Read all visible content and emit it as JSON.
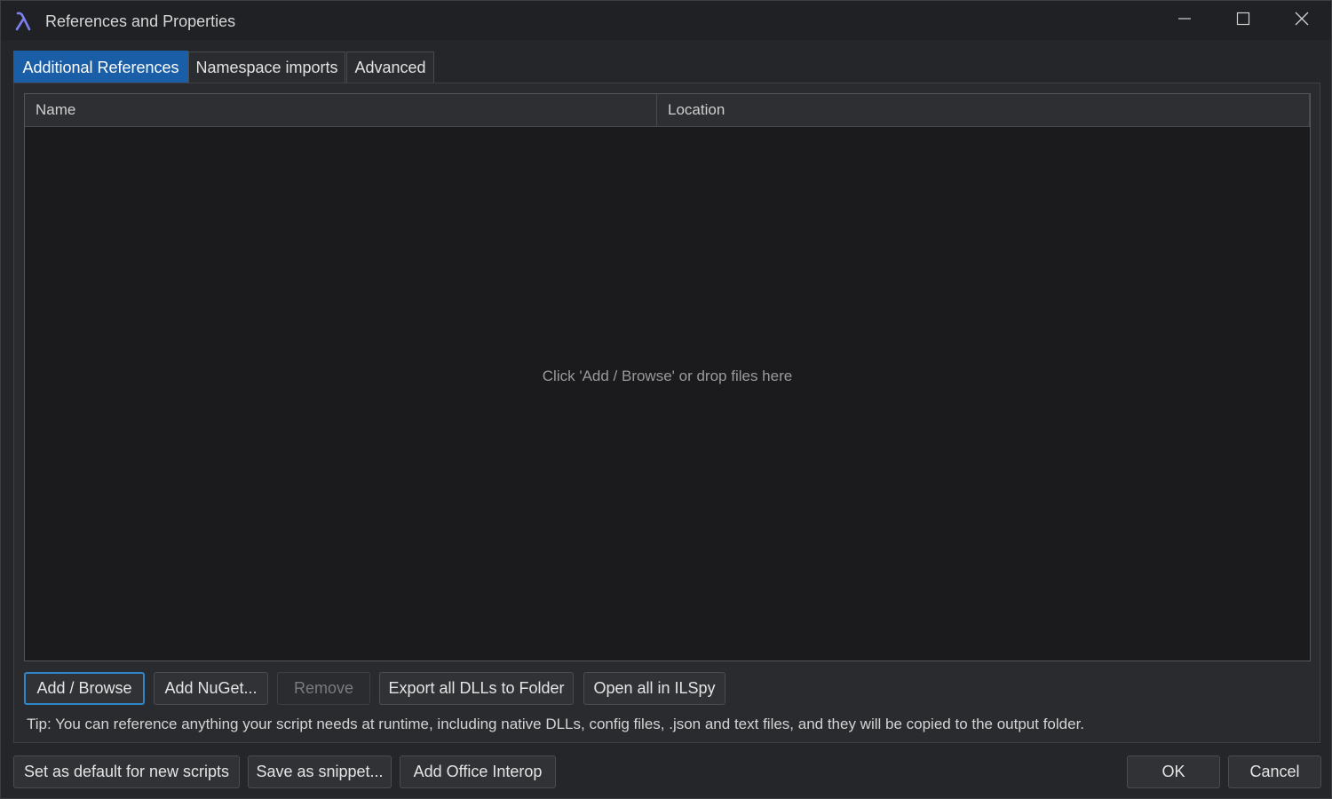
{
  "window": {
    "title": "References and Properties",
    "icons": {
      "app": "linqpad-lambda-icon",
      "minimize": "minimize-icon",
      "maximize": "maximize-icon",
      "close": "close-icon"
    },
    "accent_color": "#1b5ea8"
  },
  "tabs": [
    {
      "label": "Additional References",
      "active": true
    },
    {
      "label": "Namespace imports",
      "active": false
    },
    {
      "label": "Advanced",
      "active": false
    }
  ],
  "references_list": {
    "columns": [
      "Name",
      "Location"
    ],
    "rows": [],
    "empty_hint": "Click 'Add / Browse' or drop files here"
  },
  "actions": {
    "add_browse": "Add / Browse",
    "add_nuget": "Add NuGet...",
    "remove": "Remove",
    "export_dlls": "Export all DLLs to Folder",
    "open_ilspy": "Open all in ILSpy"
  },
  "tip": "Tip: You can reference anything your script needs at runtime, including native DLLs, config files, .json and text files, and they will be copied to the output folder.",
  "footer": {
    "set_default": "Set as default for new scripts",
    "save_snippet": "Save as snippet...",
    "add_office_interop": "Add Office Interop",
    "ok": "OK",
    "cancel": "Cancel"
  }
}
